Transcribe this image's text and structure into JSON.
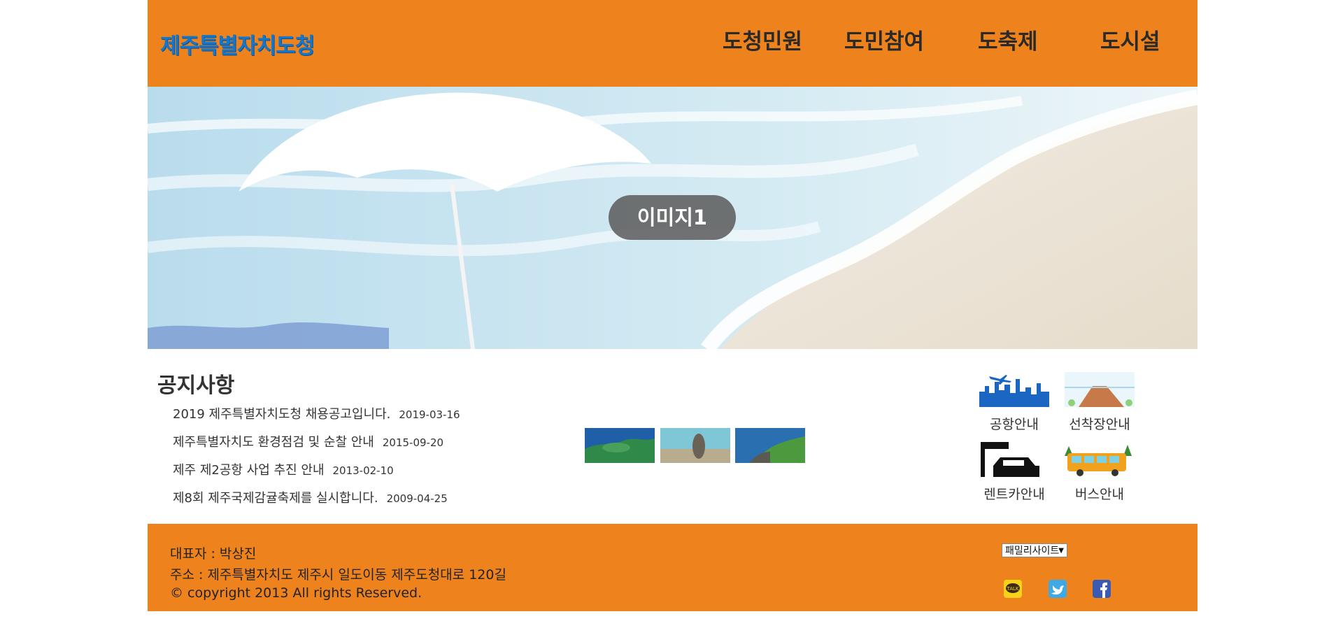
{
  "header": {
    "logo": "제주특별자치도청",
    "nav": [
      "도청민원",
      "도민참여",
      "도축제",
      "도시설"
    ]
  },
  "hero": {
    "label": "이미지1"
  },
  "notices": {
    "title": "공지사항",
    "items": [
      {
        "text": "2019 제주특별자치도청 채용공고입니다.",
        "date": "2019-03-16"
      },
      {
        "text": "제주특별자치도 환경점검 및 순찰 안내",
        "date": "2015-09-20"
      },
      {
        "text": "제주 제2공항 사업 추진 안내",
        "date": "2013-02-10"
      },
      {
        "text": "제8회 제주국제감귤축제를 실시합니다.",
        "date": "2009-04-25"
      }
    ]
  },
  "quick_links": [
    "공항안내",
    "선착장안내",
    "렌트카안내",
    "버스안내"
  ],
  "footer": {
    "representative": "대표자 : 박상진",
    "address": "주소 : 제주특별자치도 제주시 일도이동 제주도청대로 120길",
    "copyright": "© copyright 2013 All rights Reserved.",
    "family_site": "패밀리사이트"
  },
  "colors": {
    "brand_orange": "#ee831d",
    "logo_blue": "#1776c7"
  },
  "icons": [
    "kakaotalk-icon",
    "twitter-icon",
    "facebook-icon"
  ]
}
